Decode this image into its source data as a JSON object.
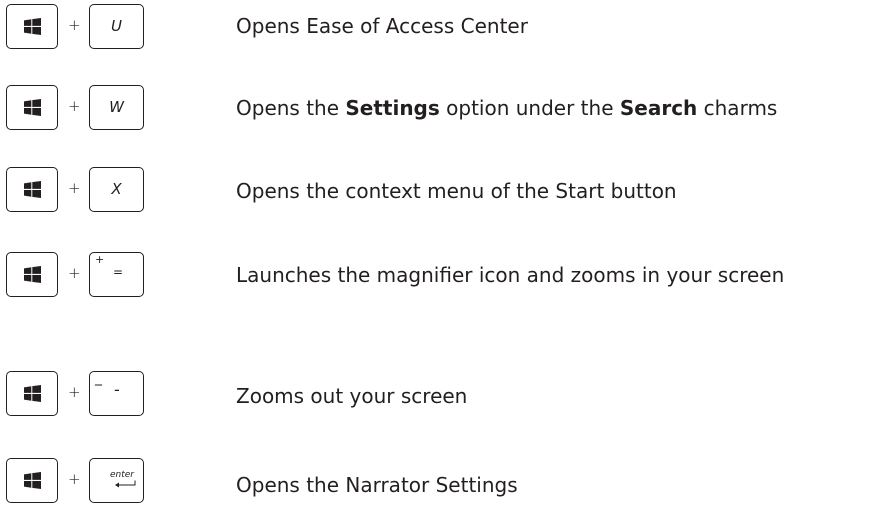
{
  "plus_sign": "+",
  "rows": [
    {
      "key": "U",
      "description": "Opens Ease of Access Center"
    },
    {
      "key": "W",
      "description_parts": [
        "Opens the ",
        "Settings",
        " option under the ",
        "Search",
        " charms"
      ]
    },
    {
      "key": "X",
      "description": "Opens the context menu of the Start button"
    },
    {
      "key_top": "+",
      "key_main": "=",
      "description": "Launches the magnifier icon and zooms in your screen"
    },
    {
      "key_top": "_",
      "key_main": "-",
      "description": "Zooms out your screen"
    },
    {
      "key": "enter",
      "description": "Opens the Narrator Settings"
    }
  ],
  "icons": {
    "windows_key": "windows-logo-icon",
    "enter_key": "enter-arrow-icon"
  },
  "colors": {
    "ink": "#231f20",
    "background": "#ffffff"
  }
}
